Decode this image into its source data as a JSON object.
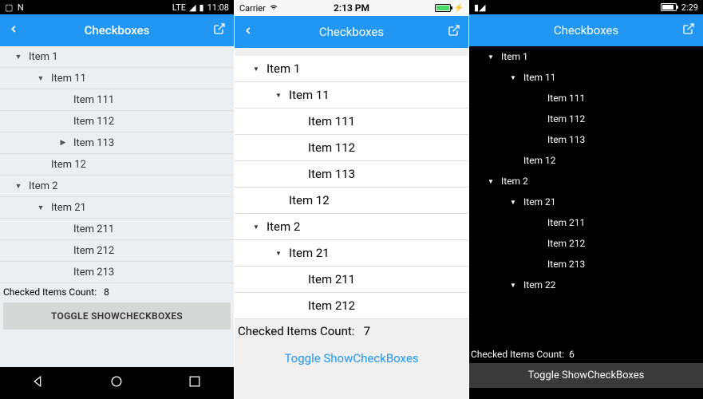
{
  "android": {
    "status": {
      "time": "11:08",
      "lte": "LTE"
    },
    "header": {
      "title": "Checkboxes"
    },
    "rows": [
      {
        "indent": 0,
        "arrow": "down",
        "label": "Item 1"
      },
      {
        "indent": 1,
        "arrow": "down",
        "label": "Item 11"
      },
      {
        "indent": 2,
        "arrow": "",
        "label": "Item 111"
      },
      {
        "indent": 2,
        "arrow": "",
        "label": "Item 112"
      },
      {
        "indent": 2,
        "arrow": "right",
        "label": "Item 113"
      },
      {
        "indent": 1,
        "arrow": "",
        "label": "Item 12"
      },
      {
        "indent": 0,
        "arrow": "down",
        "label": "Item 2"
      },
      {
        "indent": 1,
        "arrow": "down",
        "label": "Item 21"
      },
      {
        "indent": 2,
        "arrow": "",
        "label": "Item 211"
      },
      {
        "indent": 2,
        "arrow": "",
        "label": "Item 212"
      },
      {
        "indent": 2,
        "arrow": "",
        "label": "Item 213"
      }
    ],
    "status_label": "Checked Items Count:",
    "status_value": "8",
    "toggle_label": "TOGGLE SHOWCHECKBOXES"
  },
  "ios": {
    "status": {
      "carrier": "Carrier",
      "time": "2:13 PM"
    },
    "header": {
      "title": "Checkboxes"
    },
    "rows": [
      {
        "indent": 0,
        "arrow": "down",
        "label": "Item 1"
      },
      {
        "indent": 1,
        "arrow": "down",
        "label": "Item 11"
      },
      {
        "indent": 2,
        "arrow": "",
        "label": "Item 111"
      },
      {
        "indent": 2,
        "arrow": "",
        "label": "Item 112"
      },
      {
        "indent": 2,
        "arrow": "",
        "label": "Item 113"
      },
      {
        "indent": 1,
        "arrow": "",
        "label": "Item 12"
      },
      {
        "indent": 0,
        "arrow": "down",
        "label": "Item 2"
      },
      {
        "indent": 1,
        "arrow": "down",
        "label": "Item 21"
      },
      {
        "indent": 2,
        "arrow": "",
        "label": "Item 211"
      },
      {
        "indent": 2,
        "arrow": "",
        "label": "Item 212"
      }
    ],
    "status_label": "Checked Items Count:",
    "status_value": "7",
    "toggle_label": "Toggle ShowCheckBoxes"
  },
  "wp": {
    "status": {
      "time": "2:29"
    },
    "header": {
      "title": "Checkboxes"
    },
    "rows": [
      {
        "indent": 0,
        "arrow": "down",
        "label": "Item 1"
      },
      {
        "indent": 1,
        "arrow": "down",
        "label": "Item 11"
      },
      {
        "indent": 2,
        "arrow": "",
        "label": "Item 111"
      },
      {
        "indent": 2,
        "arrow": "",
        "label": "Item 112"
      },
      {
        "indent": 2,
        "arrow": "",
        "label": "Item 113"
      },
      {
        "indent": 1,
        "arrow": "",
        "label": "Item 12"
      },
      {
        "indent": 0,
        "arrow": "down",
        "label": "Item 2"
      },
      {
        "indent": 1,
        "arrow": "down",
        "label": "Item 21"
      },
      {
        "indent": 2,
        "arrow": "",
        "label": "Item 211"
      },
      {
        "indent": 2,
        "arrow": "",
        "label": "Item 212"
      },
      {
        "indent": 2,
        "arrow": "",
        "label": "Item 213"
      },
      {
        "indent": 1,
        "arrow": "down",
        "label": "Item 22"
      }
    ],
    "status_label": "Checked Items Count:",
    "status_value": "6",
    "toggle_label": "Toggle ShowCheckBoxes"
  }
}
